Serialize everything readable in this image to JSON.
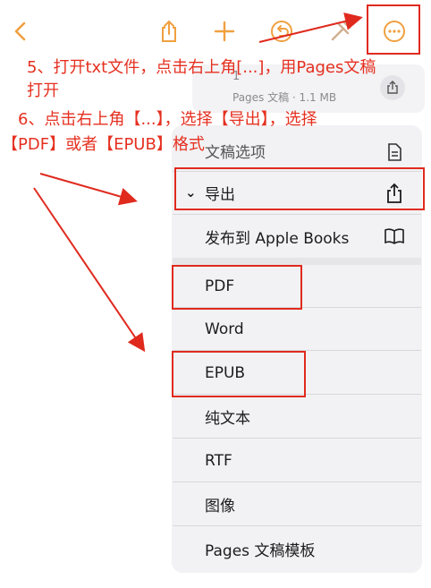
{
  "toolbar": {
    "icons": [
      "chevron-left-icon",
      "share-icon",
      "plus-icon",
      "undo-icon",
      "hammer-brush-icon",
      "more-icon"
    ],
    "accent": "#f0a040"
  },
  "document": {
    "name": "1",
    "meta": "Pages 文稿 · 1.1 MB"
  },
  "menu": {
    "doc_options": "文稿选项",
    "export_label": "导出",
    "publish_label": "发布到 Apple Books",
    "formats": [
      "PDF",
      "Word",
      "EPUB",
      "纯文本",
      "RTF",
      "图像",
      "Pages 文稿模板"
    ]
  },
  "annotations": {
    "step5_line1": "5、打开txt文件，点击右上角[...]，用Pages文稿",
    "step5_line2": "打开",
    "step6_line1": "6、点击右上角【...】，选择【导出】，选择",
    "step6_line2": "【PDF】或者【EPUB】格式",
    "color": "#e53020"
  }
}
